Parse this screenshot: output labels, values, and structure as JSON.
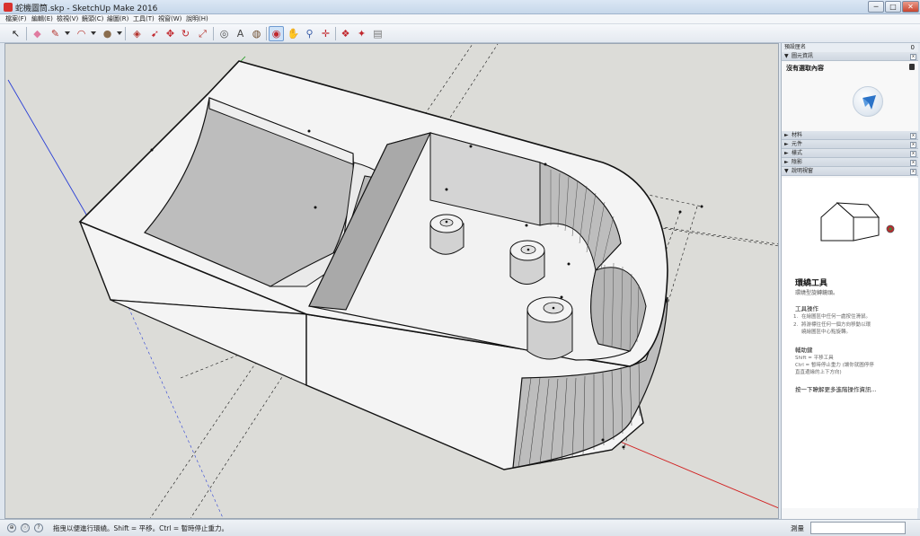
{
  "window": {
    "title": "蛇機圖筒.skp - SketchUp Make 2016",
    "min_glyph": "─",
    "max_glyph": "□",
    "close_glyph": "✕"
  },
  "menu": [
    {
      "label": "檔案(F)"
    },
    {
      "label": "編輯(E)"
    },
    {
      "label": "檢視(V)"
    },
    {
      "label": "鏡頭(C)"
    },
    {
      "label": "繪圖(R)"
    },
    {
      "label": "工具(T)"
    },
    {
      "label": "視窗(W)"
    },
    {
      "label": "說明(H)"
    }
  ],
  "toolbar": {
    "tools": [
      {
        "icon": "select-arrow-icon",
        "glyph": "↖",
        "color": "#222222"
      },
      {
        "icon": "eraser-icon",
        "glyph": "◆",
        "color": "#e07aa0"
      },
      {
        "icon": "pencil-icon",
        "glyph": "✎",
        "color": "#b3312b"
      },
      {
        "icon": "arc-icon",
        "glyph": "◠",
        "color": "#b3312b"
      },
      {
        "icon": "shape-icon",
        "glyph": "●",
        "color": "#8a6d4e"
      },
      {
        "icon": "push-pull-icon",
        "glyph": "◈",
        "color": "#b3312b"
      },
      {
        "icon": "follow-me-icon",
        "glyph": "➹",
        "color": "#c1272d"
      },
      {
        "icon": "move-icon",
        "glyph": "✥",
        "color": "#c1272d"
      },
      {
        "icon": "rotate-icon",
        "glyph": "↻",
        "color": "#c1272d"
      },
      {
        "icon": "scale-icon",
        "glyph": "⤢",
        "color": "#b3312b"
      },
      {
        "icon": "tape-measure-icon",
        "glyph": "◎",
        "color": "#4a4a4a"
      },
      {
        "icon": "text-icon",
        "glyph": "A",
        "color": "#444444"
      },
      {
        "icon": "paint-bucket-icon",
        "glyph": "◍",
        "color": "#6d4c2c"
      },
      {
        "icon": "orbit-icon",
        "glyph": "◉",
        "color": "#c1272d"
      },
      {
        "icon": "pan-icon",
        "glyph": "✋",
        "color": "#b5915c"
      },
      {
        "icon": "zoom-icon",
        "glyph": "⚲",
        "color": "#3a5ea8"
      },
      {
        "icon": "zoom-extents-icon",
        "glyph": "✛",
        "color": "#c1272d"
      },
      {
        "icon": "warehouse-icon",
        "glyph": "❖",
        "color": "#c1272d"
      },
      {
        "icon": "extension-warehouse-icon",
        "glyph": "✦",
        "color": "#c1272d"
      },
      {
        "icon": "layout-icon",
        "glyph": "▤",
        "color": "#777777"
      }
    ]
  },
  "tray": {
    "title": "預設匣名",
    "close_glyph": "0",
    "entity_info_label": "圖元資訊",
    "no_selection": "沒有選取內容",
    "collapsed_panels": [
      {
        "label": "材料"
      },
      {
        "label": "元件"
      },
      {
        "label": "樣式"
      },
      {
        "label": "陰影"
      }
    ],
    "instructor_label": "說明視窗",
    "expand_glyph": "▼",
    "collapse_glyph": "►",
    "panel_close_glyph": "x",
    "instructor": {
      "tool_name": "環繞工具",
      "tool_desc": "環繞型旋轉鏡頭。",
      "ops_title": "工具操作",
      "steps": [
        {
          "num": "1.",
          "text": "在繪圖區中任何一處按住滑鼠。"
        },
        {
          "num": "2.",
          "text": "將游標往任何一個方向移動以環"
        },
        {
          "num": "",
          "text": "繞繪圖區中心點旋轉。"
        }
      ],
      "modifier_title": "輔助鍵",
      "modifiers": [
        "Shift = 平移工具",
        "Ctrl = 暫時停止重力 (讓你就圖停停",
        "直直邊緣的上下方向)"
      ],
      "learn_more": "按一下瞭解更多進階操作資訊..."
    }
  },
  "statusbar": {
    "icons": [
      {
        "name": "geo-location-icon",
        "glyph": "⊕"
      },
      {
        "name": "credits-icon",
        "glyph": "ⓘ"
      },
      {
        "name": "help-icon",
        "glyph": "?"
      }
    ],
    "text": "拖曳以便進行環繞。Shift = 平移。Ctrl = 暫時停止重力。",
    "measure_label": "測量",
    "measure_value": ""
  },
  "colors": {
    "axis_red": "#d11f1f",
    "axis_green": "#1f9a1f",
    "axis_blue": "#2a3fd6",
    "viewport_bg": "#dcdcd8",
    "model_face": "#f4f4f4",
    "model_shade": "#bdbdbd",
    "model_edge": "#111111"
  }
}
